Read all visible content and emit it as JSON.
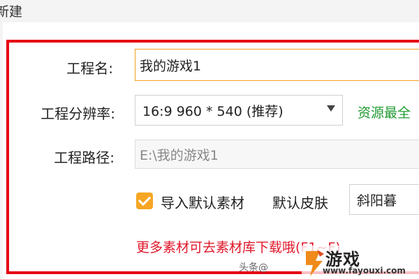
{
  "window": {
    "title": "新建"
  },
  "form": {
    "project_name": {
      "label": "工程名:",
      "value": "我的游戏1"
    },
    "resolution": {
      "label": "工程分辨率:",
      "selected": "16:9  960  * 540  (推荐)",
      "note": "资源最全"
    },
    "project_path": {
      "label": "工程路径:",
      "value": "E:\\我的游戏1"
    },
    "import_default_assets": {
      "label": "导入默认素材",
      "checked": true
    },
    "skin": {
      "label": "默认皮肤",
      "selected": "斜阳暮"
    },
    "more_assets_link": "更多素材可去素材库下载哦(F1~F)"
  },
  "watermark": {
    "source": "头条@",
    "brand": "游戏",
    "url": "www.fayouxi.com"
  },
  "colors": {
    "highlight": "#e60012",
    "accent_orange": "#f6a623",
    "note_green": "#1f9a2f",
    "link_red": "#e0182a"
  }
}
